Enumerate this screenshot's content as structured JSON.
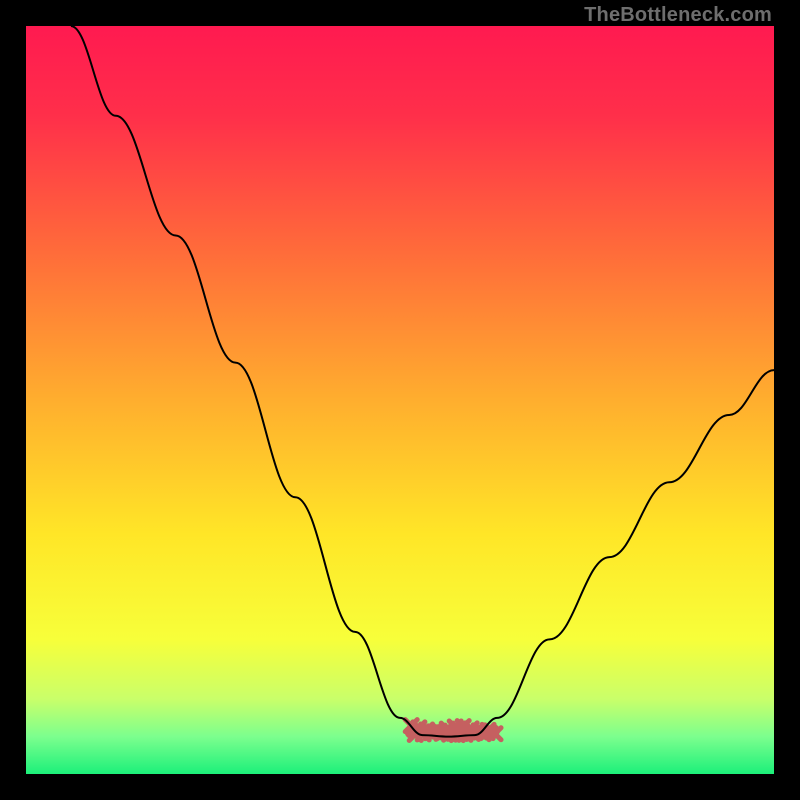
{
  "watermark": "TheBottleneck.com",
  "chart_data": {
    "type": "line",
    "title": "",
    "xlabel": "",
    "ylabel": "",
    "xlim": [
      0,
      100
    ],
    "ylim": [
      0,
      100
    ],
    "background_gradient": {
      "stops": [
        {
          "offset": 0.0,
          "color": "#ff1a50"
        },
        {
          "offset": 0.12,
          "color": "#ff2f4a"
        },
        {
          "offset": 0.3,
          "color": "#ff6b3a"
        },
        {
          "offset": 0.5,
          "color": "#ffae2e"
        },
        {
          "offset": 0.68,
          "color": "#ffe627"
        },
        {
          "offset": 0.82,
          "color": "#f7ff3a"
        },
        {
          "offset": 0.9,
          "color": "#c9ff6a"
        },
        {
          "offset": 0.95,
          "color": "#7cff8e"
        },
        {
          "offset": 1.0,
          "color": "#1cf07a"
        }
      ]
    },
    "series": [
      {
        "name": "curve",
        "stroke": "#000000",
        "stroke_width": 2,
        "points": [
          {
            "x": 6.0,
            "y": 100.0
          },
          {
            "x": 12.0,
            "y": 88.0
          },
          {
            "x": 20.0,
            "y": 72.0
          },
          {
            "x": 28.0,
            "y": 55.0
          },
          {
            "x": 36.0,
            "y": 37.0
          },
          {
            "x": 44.0,
            "y": 19.0
          },
          {
            "x": 50.0,
            "y": 7.5
          },
          {
            "x": 53.0,
            "y": 5.2
          },
          {
            "x": 56.5,
            "y": 5.0
          },
          {
            "x": 60.0,
            "y": 5.2
          },
          {
            "x": 63.0,
            "y": 7.5
          },
          {
            "x": 70.0,
            "y": 18.0
          },
          {
            "x": 78.0,
            "y": 29.0
          },
          {
            "x": 86.0,
            "y": 39.0
          },
          {
            "x": 94.0,
            "y": 48.0
          },
          {
            "x": 100.0,
            "y": 54.0
          }
        ]
      },
      {
        "name": "crosshatch-markers",
        "stroke": "#c56060",
        "stroke_width": 5,
        "area_x": [
          51.5,
          62.5
        ],
        "area_y": [
          5.0,
          6.2
        ],
        "shape": "dense-crosshatch"
      }
    ],
    "annotations": []
  }
}
